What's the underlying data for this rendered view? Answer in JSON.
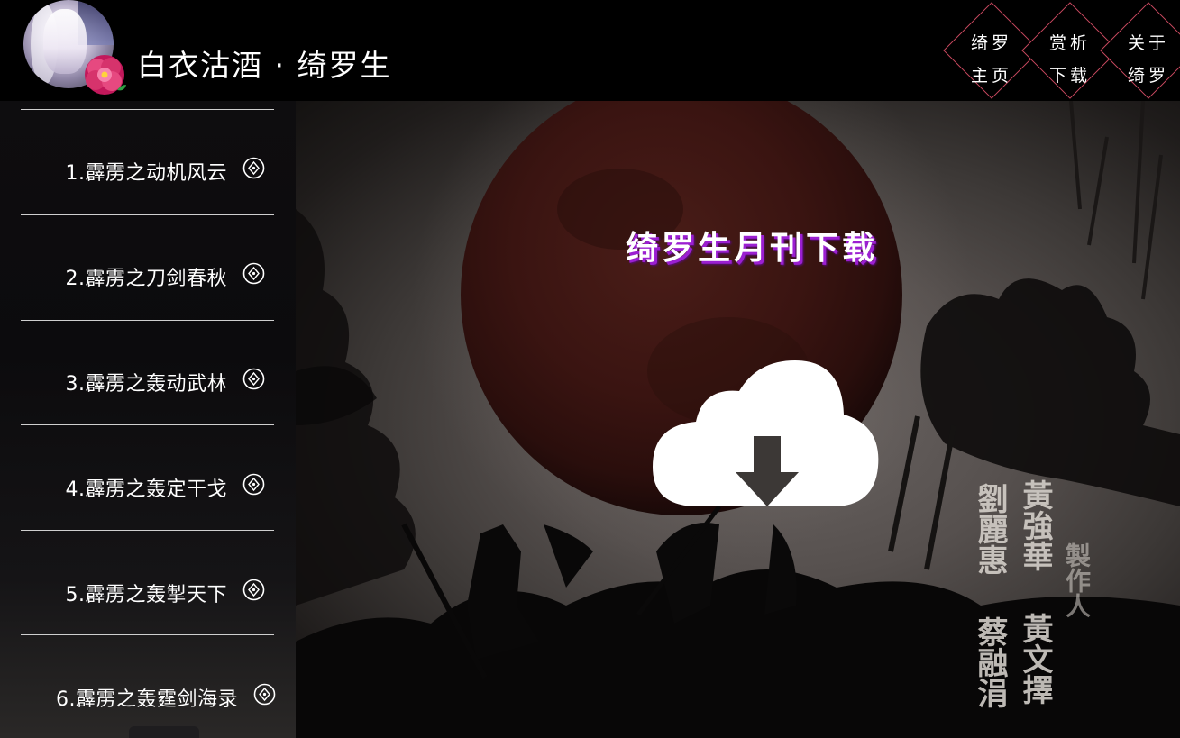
{
  "header": {
    "site_title": "白衣沽酒 · 绮罗生",
    "avatar_icon": "avatar-icon",
    "flower_icon": "peony-flower-icon"
  },
  "nav": [
    {
      "line1": "绮罗",
      "line2": "主页"
    },
    {
      "line1": "赏析",
      "line2": "下载"
    },
    {
      "line1": "关于",
      "line2": "绮罗"
    }
  ],
  "sidebar": {
    "items": [
      {
        "label": "1.霹雳之动机风云",
        "icon": "diamond-circle-icon"
      },
      {
        "label": "2.霹雳之刀剑春秋",
        "icon": "diamond-circle-icon"
      },
      {
        "label": "3.霹雳之轰动武林",
        "icon": "diamond-circle-icon"
      },
      {
        "label": "4.霹雳之轰定干戈",
        "icon": "diamond-circle-icon"
      },
      {
        "label": "5.霹雳之轰掣天下",
        "icon": "diamond-circle-icon"
      },
      {
        "label": "6.霹雳之轰霆剑海录",
        "icon": "diamond-circle-icon"
      }
    ]
  },
  "hero": {
    "title": "绮罗生月刊下载",
    "download_icon": "cloud-download-icon",
    "credits": {
      "col1": "黃強華",
      "col2": "劉麗惠",
      "col3": "黃文擇",
      "col4": "蔡融涓",
      "role": "製作人"
    }
  },
  "colors": {
    "nav_border": "#c8485f",
    "title_shadow": "#9b1fd1",
    "background": "#000000"
  }
}
